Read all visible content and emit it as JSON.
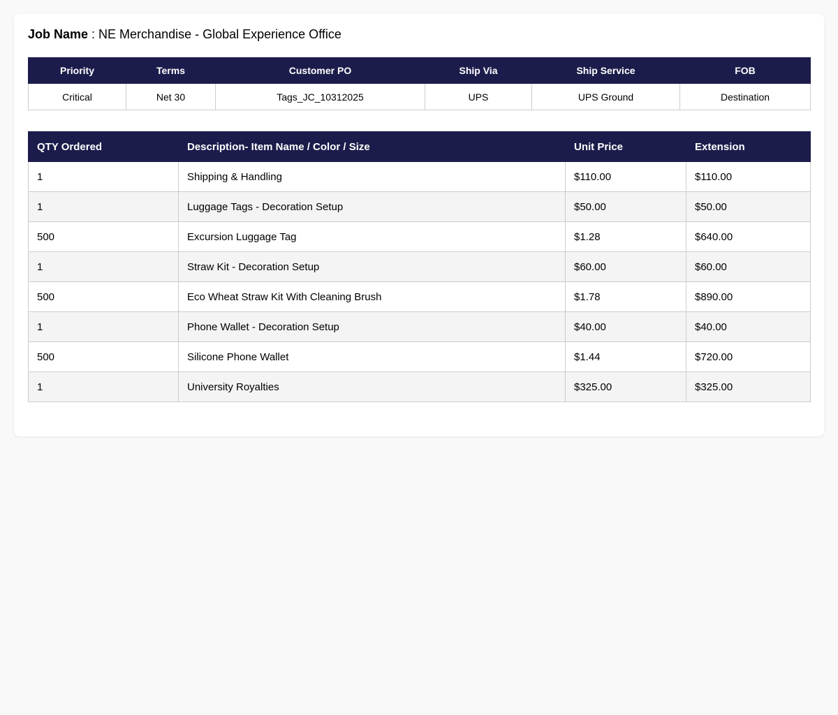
{
  "job": {
    "label": "Job Name",
    "separator": " : ",
    "value": "NE Merchandise - Global Experience Office"
  },
  "order_info": {
    "headers": [
      "Priority",
      "Terms",
      "Customer PO",
      "Ship Via",
      "Ship Service",
      "FOB"
    ],
    "values": [
      "Critical",
      "Net 30",
      "Tags_JC_10312025",
      "UPS",
      "UPS Ground",
      "Destination"
    ]
  },
  "line_items": {
    "headers": [
      "QTY Ordered",
      "Description- Item Name / Color / Size",
      "Unit Price",
      "Extension"
    ],
    "rows": [
      {
        "qty": "1",
        "description": "Shipping & Handling",
        "unit_price": "$110.00",
        "extension": "$110.00"
      },
      {
        "qty": "1",
        "description": "Luggage Tags - Decoration Setup",
        "unit_price": "$50.00",
        "extension": "$50.00"
      },
      {
        "qty": "500",
        "description": "Excursion Luggage Tag",
        "unit_price": "$1.28",
        "extension": "$640.00"
      },
      {
        "qty": "1",
        "description": "Straw Kit - Decoration Setup",
        "unit_price": "$60.00",
        "extension": "$60.00"
      },
      {
        "qty": "500",
        "description": "Eco Wheat Straw Kit With Cleaning Brush",
        "unit_price": "$1.78",
        "extension": "$890.00"
      },
      {
        "qty": "1",
        "description": "Phone Wallet - Decoration Setup",
        "unit_price": "$40.00",
        "extension": "$40.00"
      },
      {
        "qty": "500",
        "description": "Silicone Phone Wallet",
        "unit_price": "$1.44",
        "extension": "$720.00"
      },
      {
        "qty": "1",
        "description": "University Royalties",
        "unit_price": "$325.00",
        "extension": "$325.00"
      }
    ]
  },
  "colors": {
    "header_bg": "#1c1c4c",
    "header_text": "#ffffff",
    "alt_row_bg": "#f4f4f4",
    "border": "#cccccc",
    "page_bg": "#f9f9f9"
  }
}
